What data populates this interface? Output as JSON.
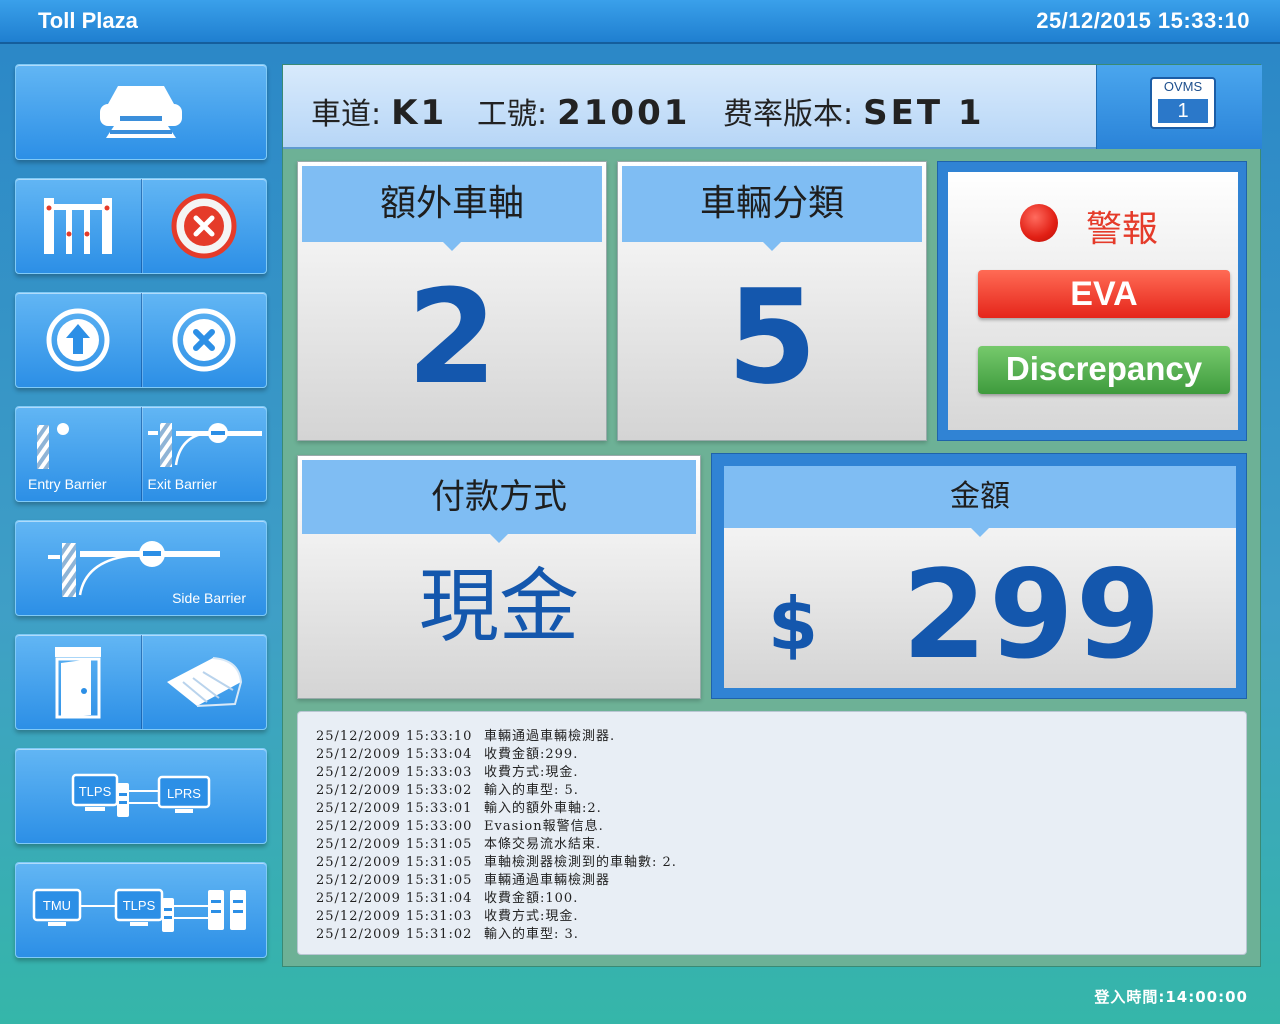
{
  "header": {
    "app_title": "Toll Plaza",
    "datetime": "25/12/2015 15:33:10"
  },
  "sidebar": {
    "buttons": [
      {
        "icons": [
          "printer-icon"
        ]
      },
      {
        "icons": [
          "gate-icon",
          "cancel-red-icon"
        ]
      },
      {
        "icons": [
          "up-arrow-icon",
          "cancel-icon"
        ]
      },
      {
        "icons": [
          "entry-barrier-icon",
          "exit-barrier-icon"
        ],
        "labels": [
          "Entry Barrier",
          "Exit Barrier"
        ]
      },
      {
        "icons": [
          "side-barrier-icon"
        ],
        "labels": [
          "Side Barrier"
        ]
      },
      {
        "icons": [
          "booth-door-icon",
          "canopy-icon"
        ]
      },
      {
        "network": [
          "TLPS",
          "LPRS"
        ]
      },
      {
        "network": [
          "TMU",
          "TLPS"
        ]
      }
    ]
  },
  "info": {
    "lane_label": "車道:",
    "lane_value": "K1",
    "staff_label": "工號:",
    "staff_value": "21001",
    "rate_label": "费率版本:",
    "rate_value": "SET 1"
  },
  "ovms": {
    "label": "OVMS",
    "value": "1"
  },
  "cards": {
    "extra_axles": {
      "title": "額外車軸",
      "value": "2"
    },
    "vehicle_class": {
      "title": "車輛分類",
      "value": "5"
    },
    "payment": {
      "title": "付款方式",
      "value": "現金"
    },
    "amount": {
      "title": "金額",
      "currency": "$",
      "value": "299"
    }
  },
  "alarm": {
    "label": "警報",
    "eva": "EVA",
    "discrepancy": "Discrepancy",
    "colors": {
      "red": "#e5251a",
      "green": "#3e9b3d"
    }
  },
  "log": [
    {
      "time": "25/12/2009 15:33:10",
      "msg": "車輛通過車輛檢測器."
    },
    {
      "time": "25/12/2009 15:33:04",
      "msg": "收費金額:299."
    },
    {
      "time": "25/12/2009 15:33:03",
      "msg": "收費方式:現金."
    },
    {
      "time": "25/12/2009 15:33:02",
      "msg": "輸入的車型: 5."
    },
    {
      "time": "25/12/2009 15:33:01",
      "msg": "輸入的額外車軸:2."
    },
    {
      "time": "25/12/2009 15:33:00",
      "msg": "Evasion報警信息."
    },
    {
      "time": "25/12/2009 15:31:05",
      "msg": "本條交易流水結束."
    },
    {
      "time": "25/12/2009 15:31:05",
      "msg": "車軸檢測器檢測到的車軸數: 2."
    },
    {
      "time": "25/12/2009 15:31:05",
      "msg": "車輛通過車輛檢測器"
    },
    {
      "time": "25/12/2009 15:31:04",
      "msg": "收費金額:100."
    },
    {
      "time": "25/12/2009 15:31:03",
      "msg": "收費方式:現金."
    },
    {
      "time": "25/12/2009 15:31:02",
      "msg": "輸入的車型: 3."
    }
  ],
  "footer": {
    "login_time": "登入時間:14:00:00"
  }
}
